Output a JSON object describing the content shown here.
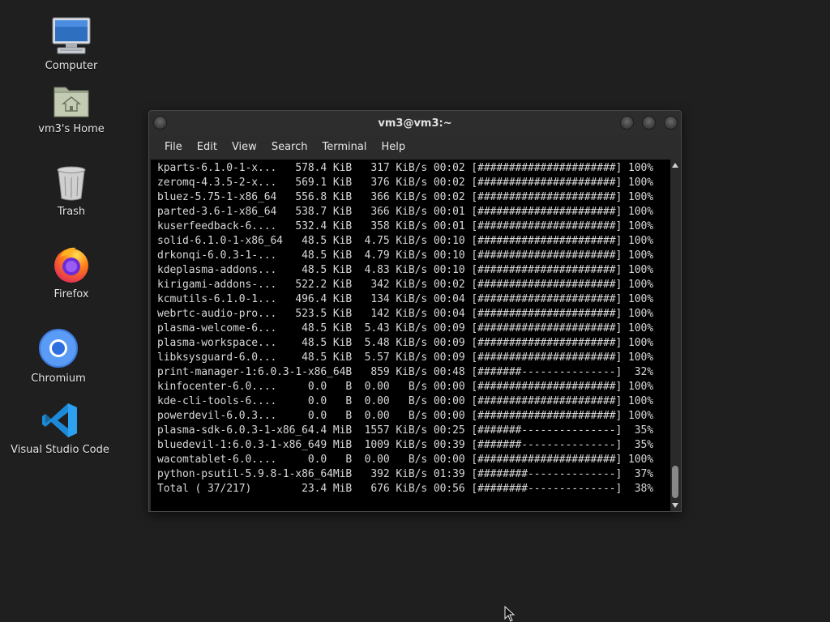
{
  "desktop": {
    "icons": [
      {
        "label": "Computer",
        "icon": "computer-icon"
      },
      {
        "label": "vm3's Home",
        "icon": "home-folder-icon"
      },
      {
        "label": "Trash",
        "icon": "trash-icon"
      },
      {
        "label": "Firefox",
        "icon": "firefox-icon"
      },
      {
        "label": "Chromium",
        "icon": "chromium-icon"
      },
      {
        "label": "Visual Studio Code",
        "icon": "vscode-icon"
      }
    ]
  },
  "window": {
    "title": "vm3@vm3:~",
    "menu": [
      "File",
      "Edit",
      "View",
      "Search",
      "Terminal",
      "Help"
    ],
    "terminal_lines": [
      "kparts-6.1.0-1-x...   578.4 KiB   317 KiB/s 00:02 [######################] 100%",
      "zeromq-4.3.5-2-x...   569.1 KiB   376 KiB/s 00:02 [######################] 100%",
      "bluez-5.75-1-x86_64   556.8 KiB   366 KiB/s 00:02 [######################] 100%",
      "parted-3.6-1-x86_64   538.7 KiB   366 KiB/s 00:01 [######################] 100%",
      "kuserfeedback-6....   532.4 KiB   358 KiB/s 00:01 [######################] 100%",
      "solid-6.1.0-1-x86_64   48.5 KiB  4.75 KiB/s 00:10 [######################] 100%",
      "drkonqi-6.0.3-1-...    48.5 KiB  4.79 KiB/s 00:10 [######################] 100%",
      "kdeplasma-addons...    48.5 KiB  4.83 KiB/s 00:10 [######################] 100%",
      "kirigami-addons-...   522.2 KiB   342 KiB/s 00:02 [######################] 100%",
      "kcmutils-6.1.0-1...   496.4 KiB   134 KiB/s 00:04 [######################] 100%",
      "webrtc-audio-pro...   523.5 KiB   142 KiB/s 00:04 [######################] 100%",
      "plasma-welcome-6...    48.5 KiB  5.43 KiB/s 00:09 [######################] 100%",
      "plasma-workspace...    48.5 KiB  5.48 KiB/s 00:09 [######################] 100%",
      "libksysguard-6.0...    48.5 KiB  5.57 KiB/s 00:09 [######################] 100%",
      "print-manager-1:6.0.3-1-x86_64B   859 KiB/s 00:48 [#######---------------]  32%",
      "kinfocenter-6.0....     0.0   B  0.00   B/s 00:00 [######################] 100%",
      "kde-cli-tools-6....     0.0   B  0.00   B/s 00:00 [######################] 100%",
      "powerdevil-6.0.3...     0.0   B  0.00   B/s 00:00 [######################] 100%",
      "plasma-sdk-6.0.3-1-x86_64.4 MiB  1557 KiB/s 00:25 [#######---------------]  35%",
      "bluedevil-1:6.0.3-1-x86_649 MiB  1009 KiB/s 00:39 [#######---------------]  35%",
      "wacomtablet-6.0....     0.0   B  0.00   B/s 00:00 [######################] 100%",
      "python-psutil-5.9.8-1-x86_64MiB   392 KiB/s 01:39 [########--------------]  37%",
      "Total ( 37/217)        23.4 MiB   676 KiB/s 00:56 [########--------------]  38%"
    ]
  },
  "colors": {
    "desktop_bg": "#1f1f1f",
    "terminal_bg": "#000000",
    "terminal_fg": "#d8d8d8"
  }
}
